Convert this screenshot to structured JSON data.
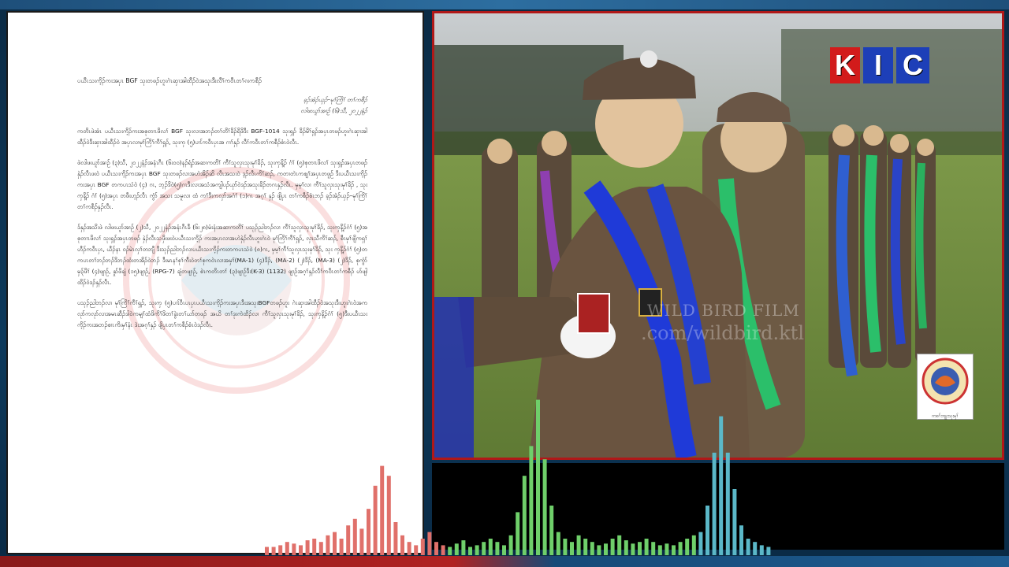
{
  "document": {
    "title": "ပယီၤသးကိ့ၣ်ကးအပှၤ BGF သုးတဖၣ်ဟူးဂဲၤဆှၢအါထီၣ်ဝဲအသုးဒီးလီၢ်ကဝီၤတၢ်ၵးကစီၣ်",
    "byline": "ခ့ၣ်အဲၣ်ယှၣ်–မုၢ်ကြိၢ် တၢ်ကစီၣ်",
    "date": "လါဖးယူာ်အၢဉ် (၆)သီ, ၂၀၂၂နံၣ်",
    "paragraphs": [
      "ကတိၤဖဲအံၤ ပယီၤသးကိ့ၣ်ကးအစုတၢၤဖိလၢ် BGF သုးလၢအဘၣ်တၢ်တိၢ်ခိၣ်ရိဖိဒီး BGF-1014 သုးရှၣ် ခိၣ်မိၢ်ရှၣ်အပှၤတဖၣ်ဟူးဂဲၤဆှၢအါထီၣ်ဝဲဒီးဆှၢအါထီၣ်ဝဲ အပှၤလၢမုၢ်ကြိၢ်ကီၢ်ရှၣ်, သုးကှ (၅)ပၢၤ်ကဝီၤပှၤအ ဂၢၢ်နှၣ် လီၢ်ကဝီၤတၢ်ကစီၣ်စံၤဝဲလီၤ.",
      "ဖဲလါဖးယူာ်အၢဉ် (၃)သီ, ၂၀၂၂နံၣ်အနံၤဂီၤ (၆း၀၀)နၣ်ရံၣ်အဆၢကတိၢ် ကီၢ်သူလှၤသုးမုၢ်ခိၣ်, သုးကှနိ့ၣ် ဂံၢ် (၅)စုတၢၤဖိလၢ် သုးရှၣ်အပှၤတဖၣ်နှဲၣ်လီၤဖးဝဲ ပယီၤသးကိ့ၣ်ကးအပှၤ BGF သုးတဖၣ်လၢအဟဲအိၣ်ဆိ လီၤအသး၀ဲ ဒ့ၣ်လီၤကိၢ်ဆၣ်, ကတၢတဲၤကစျၢ်အပှၤတဖူဉ် ဒီးပယီၤသးကိ့ၣ်ကးအပှၤ BGF တကပၤသံဝဲ (၄) ဂၤ, ဘ့ၣ်ဒိဝဲ(၅)ဂၤဒီးလၢအသံအကျါပၣ်ယှာ်ဝဲဒၣ်အသုးခိၣ်တဂၤနှၣ်လီၤ. မှမ့ၢ်လၢ ကီၢ်သူလှၤသုးမုၢ်ခိၣ် , သုးကှနိ့ၣ် ဂံၢ် (၅)အပှၤ တဖီးဟ့ၣ်လီၤ ကွံာ် အသး သမူလၢ ထံ ကၢ်ဒီးကလှာ်အဂံၢ် (၁)ဂၤ အဂ့ၢ် နှၣ် ဖျိပှၤ တၢ်ကစီၣ်စံၤဘၣ် ခ့ၣ်အဲၣ်ယှၣ်–မုၢ်ကြိၢ် တၢ်ကစီၣ်နှၣ်လီၤ.",
      "ဒ်နှၣ်အသိးဖဲ လါဖးယူာ်အၢဉ် (၂)သီ, ၂၀၂၂နံၣ်အနံၤဂီၤခီ (၆း၂၈)မံးနံးအဆၢကတိၢ် ပသုၣ်ညါဘၣ်လၢ ကီၢ်သူလှၤသုးမုၢ်ခိၣ်, သုးကှနိ့ၣ်ဂံၢ် (၅)အစုတၢၤဖိလၢ် သုးရှၣ်အပှၤတဖၣ် နှဲၣ်လီၤသဖှိးဖးဝဲပယီၤသးကိ့ၣ် ကးအပှၤလၢအဟဲနှဲၣ်လီၤဟူးဂဲၤဝဲ မုၢ်ကြိၢ်ကီၢ်ရှၣ်, လှၤသီကိၢ်ဆၣ်, စီၤမှၢ်ဖျိကရှၢ်ဟီၣ်ကဝီၤပှၤ, ယီၣ်နၤ ဝၣ်မဲၤလှၢ်တဘျီ ဒီးသုၣ်ညါဘၣ်လၢပယီၤသးကိ့ၣ်ကးတကပၤသံဝဲ (၈)ဂၤ, မှမ့ၢ်ကီၢ်သူလှၤသုးမုၢ်ခိၣ်, သုး ကှနိ့ၣ်ဂံၢ် (၅)တကပၤတၢ်ဘၣ်ဘၣ်ဒိဘၣ်ထံးတအိၣ်ဝဲဘၣ် ဒီးမၤနၢ်စုၢ်ကီးဝဲတၢ်စုကဝဲၤလၢအမှၢ်(MA-1) (၄)ဒိၣ်, (MA-2) (၂)ဒိၣ်, (MA-3) (၂)ဒိၣ်, စုကွံာ် မှ၃်ဖိၢ် (၄)ဖျၢဉ်, နှုာ်ဖိချံ (၁၅)ဖျၢဉ်, (RPG-7) ချံတဖျၢဉ်, စဲၤကတိၤတၢ် (၃)ဖျၢဉ်ဒီး(K-3) (1132) ဖျၢဉ်အဂ့ၢ်နှၣ်လီၢ်ကဝီၤတၢ်ကစီၣ် ဟ်ဖျါထိၣ်ဝဲဒၣ်နှၣ်လီၤ.",
      "ပသုၣ်ညါဘၣ်လၢ မုၢ်ကြိၢ်ကီၢ်ရှၣ်, သုးကှ (၅)ပၢၤ်ဝီၤပၤပှၤပယီၤသးကိ့ၣ်ကးအပှၤဒီးအသုးBGFတဖၣ်ဟူး ဂဲၤဆှၢအါထီၣ်ဝဲအသုးဒီးဟူးဂဲၤဝဲအကလုာ်ကလုာ်လၢအမၤဆီၣ်ဒါဝဲကမျၢ်ထံဖိကိၢ်ဖိတၢ်ခွဲးတၢ်ယာ်တဖၣ် အယိ တၢ်ဒုးကဲထိၣ်လၢ ကီၢ်သူလှၤသုးမုၢ်ခိၣ်, သုးကှနိ့ၣ်ဂံၢ် (၅)ဒီးပယီၤသးကိ့ၣ်ကးအဘၣ်စၢၤကိးမှၢ်နံၤ ဒဲးအဂ့ၢ်နှၣ် ဖျိပှၤတၢ်ကစီၣ်စံၤဝဲဒၣ်လီၤ."
    ]
  },
  "video": {
    "channel_logo": {
      "letters": [
        "K",
        "I",
        "C"
      ],
      "colors": {
        "k_bg": "#d21b1b",
        "ic_bg": "#1d3fb8"
      }
    },
    "watermark_line1": "WILD BIRD FILM",
    "watermark_line2": ".com/wildbird.ktl",
    "corner_emblem_caption": "ကစၢ်ဘျုးသုးမှၢ်"
  },
  "audio_visualizer": {
    "colors": [
      "#e0706a",
      "#6fcf6a",
      "#5bb8c8"
    ],
    "levels": [
      0.05,
      0.05,
      0.06,
      0.08,
      0.07,
      0.06,
      0.09,
      0.1,
      0.08,
      0.12,
      0.14,
      0.1,
      0.18,
      0.22,
      0.16,
      0.28,
      0.42,
      0.54,
      0.48,
      0.2,
      0.12,
      0.08,
      0.06,
      0.1,
      0.14,
      0.08,
      0.06,
      0.05,
      0.07,
      0.09,
      0.05,
      0.06,
      0.08,
      0.1,
      0.08,
      0.06,
      0.12,
      0.26,
      0.48,
      0.66,
      0.94,
      0.58,
      0.3,
      0.14,
      0.1,
      0.08,
      0.12,
      0.1,
      0.08,
      0.06,
      0.07,
      0.1,
      0.12,
      0.09,
      0.07,
      0.08,
      0.1,
      0.08,
      0.06,
      0.07,
      0.06,
      0.08,
      0.1,
      0.12,
      0.14,
      0.3,
      0.62,
      0.84,
      0.62,
      0.4,
      0.18,
      0.1,
      0.08,
      0.06,
      0.05
    ]
  }
}
